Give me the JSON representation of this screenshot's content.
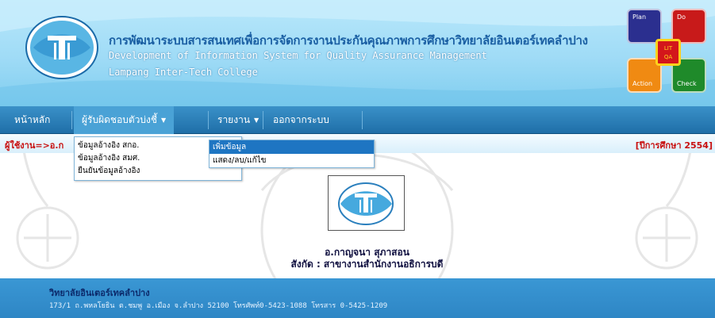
{
  "header": {
    "title_th": "การพัฒนาระบบสารสนเทศเพื่อการจัดการงานประกันคุณภาพการศึกษาวิทยาลัยอินเตอร์เทคลำปาง",
    "title_en": "Development of Information System for Quality Assurance Management",
    "college": "Lampang Inter-Tech College",
    "pdca": {
      "plan": "Plan",
      "do": "Do",
      "check": "Check",
      "action": "Action",
      "center_top": "LIT",
      "center_bottom": "QA"
    }
  },
  "nav": {
    "home": "หน้าหลัก",
    "responsible": "ผู้รับผิดชอบตัวบ่งชี้",
    "report": "รายงาน",
    "logout": "ออกจากระบบ"
  },
  "user_bar": {
    "user_label": "ผู้ใช้งาน=>อ.ก",
    "academic_year": "[ปีการศึกษา 2554]"
  },
  "dropdown": {
    "items": [
      "ข้อมูลอ้างอิง สกอ.",
      "ข้อมูลอ้างอิง สมศ.",
      "ยืนยันข้อมูลอ้างอิง"
    ]
  },
  "submenu": {
    "items": [
      "เพิ่มข้อมูล",
      "แสดง/ลบ/แก้ไข"
    ]
  },
  "profile": {
    "name": "อ.กาญจนา สุภาสอน",
    "department": "สังกัด : สาขางานสำนักงานอธิการบดี"
  },
  "footer": {
    "name": "วิทยาลัยอินเตอร์เทคลำปาง",
    "address": "173/1 ถ.พหลโยธิน ต.ชมพู อ.เมือง จ.ลำปาง 52100 โทรศัพท์0-5423-1088 โทรสาร 0-5425-1209"
  },
  "colors": {
    "header_bg": "#9fdbf6",
    "nav_bg": "#2b80ba",
    "accent_red": "#c8100f",
    "footer_bg": "#3390cd"
  }
}
